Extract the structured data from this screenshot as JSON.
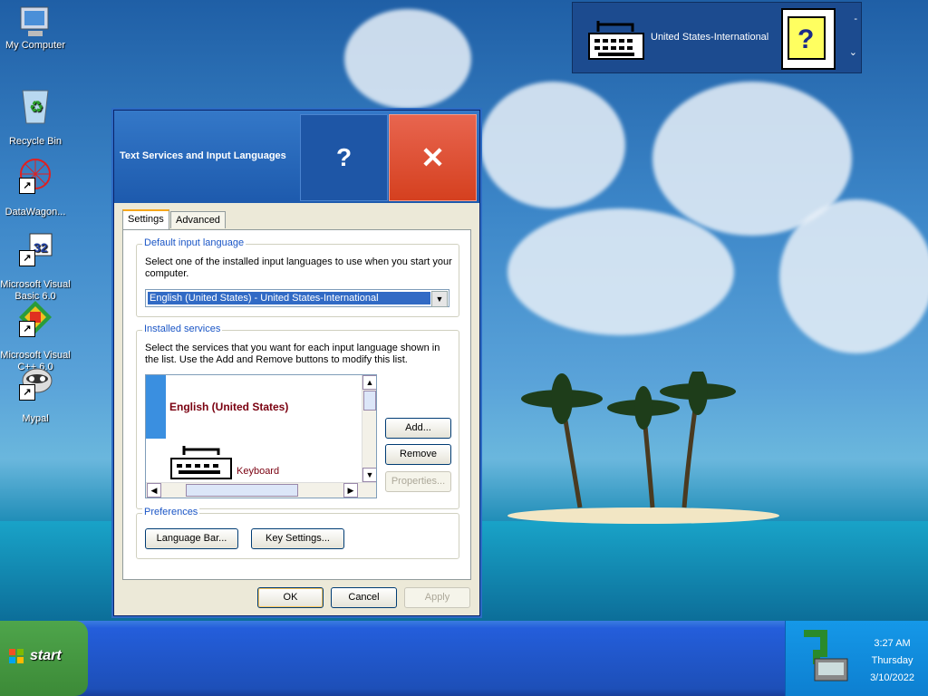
{
  "desktop": {
    "icons": [
      {
        "label": "My Computer"
      },
      {
        "label": "Recycle Bin"
      },
      {
        "label": "DataWagon..."
      },
      {
        "label": "Microsoft Visual Basic 6.0"
      },
      {
        "label": "Microsoft Visual C++ 6.0"
      },
      {
        "label": "Mypal"
      }
    ]
  },
  "langbar": {
    "language": "United States-International",
    "minimize": "-",
    "options": "⌄"
  },
  "dialog": {
    "title": "Text Services and Input Languages",
    "help_glyph": "?",
    "close_glyph": "✕",
    "tabs": [
      {
        "label": "Settings"
      },
      {
        "label": "Advanced"
      }
    ],
    "default_lang": {
      "legend": "Default input language",
      "desc": "Select one of the installed input languages to use when you start your computer.",
      "selected": "English (United States) - United States-International"
    },
    "installed": {
      "legend": "Installed services",
      "desc": "Select the services that you want for each input language shown in the list. Use the Add and Remove buttons to modify this list.",
      "language": "English (United States)",
      "service_type": "Keyboard",
      "add": "Add...",
      "remove": "Remove",
      "properties": "Properties..."
    },
    "preferences": {
      "legend": "Preferences",
      "language_bar": "Language Bar...",
      "key_settings": "Key Settings..."
    },
    "ok": "OK",
    "cancel": "Cancel",
    "apply": "Apply"
  },
  "taskbar": {
    "start": "start",
    "time": "3:27 AM",
    "day": "Thursday",
    "date": "3/10/2022"
  }
}
